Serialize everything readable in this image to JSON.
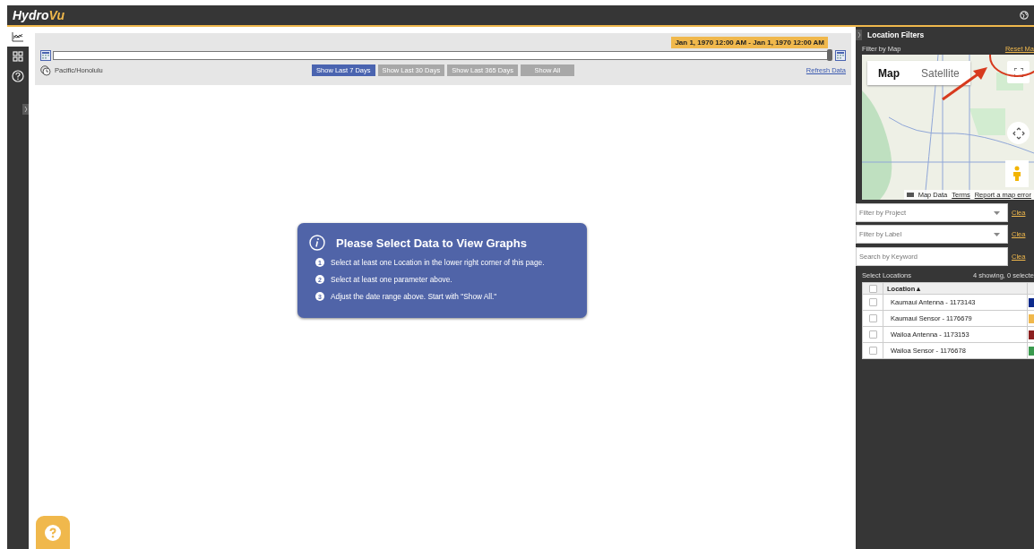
{
  "header": {
    "logo": "Hydro",
    "logo_accent": "Vu"
  },
  "sidebar": {
    "items": [
      {
        "kind": "chart",
        "selected": true
      },
      {
        "kind": "grid",
        "selected": false
      },
      {
        "kind": "help",
        "selected": false
      }
    ]
  },
  "date_filter": {
    "range": "Jan 1, 1970 12:00 AM - Jan 1, 1970 12:00 AM",
    "slider": {
      "level": 1
    },
    "timezone": "Pacific/Honolulu",
    "presets": [
      {
        "label": "Show Last 7 Days",
        "selected": true
      },
      {
        "label": "Show Last 30 Days",
        "selected": false
      },
      {
        "label": "Show Last 365 Days",
        "selected": false
      },
      {
        "label": "Show All",
        "selected": false
      }
    ],
    "refresh": "Refresh Data"
  },
  "message": {
    "title": "Please Select Data to View Graphs",
    "steps": [
      {
        "number": "1",
        "text": "Select at least one Location in the lower right corner of this page."
      },
      {
        "number": "2",
        "text": "Select at least one parameter above."
      },
      {
        "number": "3",
        "text": "Adjust the date range above. Start with \"Show All.\""
      }
    ]
  },
  "location_filters": {
    "title": "Location Filters",
    "map_label": "Filter by Map",
    "reset": "Reset Ma",
    "map": {
      "types": [
        {
          "label": "Map",
          "selected": true
        },
        {
          "label": "Satellite",
          "selected": false
        }
      ],
      "footer": [
        "Map Data",
        "Terms",
        "Report a map error"
      ]
    },
    "filters": [
      {
        "kind": "select",
        "placeholder": "Filter by Project",
        "clear": "Clea"
      },
      {
        "kind": "select",
        "placeholder": "Filter by Label",
        "clear": "Clea"
      },
      {
        "kind": "text",
        "placeholder": "Search by Keyword",
        "clear": "Clea"
      }
    ],
    "select_label": "Select Locations",
    "count": "4 showing, 0 selecte",
    "table": {
      "select_all": {
        "checked": false
      },
      "columns": [
        "Location ▴"
      ],
      "rows": [
        {
          "name": "Kaumaui Antenna - 1173143",
          "checked": false,
          "color": "#0d2a8c"
        },
        {
          "name": "Kaumaui Sensor - 1176679",
          "checked": false,
          "color": "#f0b84c"
        },
        {
          "name": "Wailoa Antenna - 1173153",
          "checked": false,
          "color": "#8c1f1f"
        },
        {
          "name": "Wailoa Sensor - 1176678",
          "checked": false,
          "color": "#3a9a4e"
        }
      ]
    }
  }
}
